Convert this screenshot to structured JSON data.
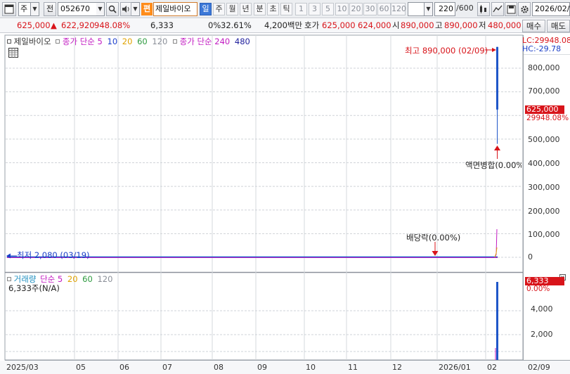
{
  "toolbar": {
    "market": "주",
    "prev_label": "전",
    "code": "052670",
    "stock_name": "제일바이오",
    "badge": "편",
    "periods": [
      "일",
      "주",
      "월",
      "년",
      "분",
      "초",
      "틱"
    ],
    "numbers": [
      "1",
      "3",
      "5",
      "10",
      "20",
      "30",
      "60",
      "120"
    ],
    "count_value": "220",
    "count_total": "/600",
    "date": "2026/02/"
  },
  "quote": {
    "price": "625,000",
    "change_arrow": "▲",
    "change": "622,920",
    "change_pct": "948.08%",
    "volume": "6,333",
    "zero_pct": "0%",
    "turnover_pct": "32.61%",
    "amount": "4,200백만",
    "bid_label": "호가",
    "ask": "625,000",
    "bid": "624,000",
    "open_label": "시",
    "open": "890,000",
    "high_label": "고",
    "high": "890,000",
    "low_label": "저",
    "low": "480,000",
    "buy_label": "매수",
    "sell_label": "매도"
  },
  "price_panel": {
    "legend_name": "제일바이오",
    "ma_label": "종가 단순",
    "ma_periods": [
      "5",
      "10",
      "20",
      "60",
      "120"
    ],
    "ma_colors": [
      "#c21bc2",
      "#1e3fcc",
      "#e0a200",
      "#2e9b40",
      "#8a8f98"
    ],
    "ma2_label": "종가 단순",
    "ma2_periods": [
      "240",
      "480"
    ],
    "ma2_colors": [
      "#c21bc2",
      "#1e1e9c"
    ],
    "high_annotation": "최고 890,000 (02/09)",
    "low_annotation": "최저 2,080 (03/19)",
    "split_annotation": "액면병합(0.00%",
    "dividend_annotation": "배당락(0.00%)",
    "lc_label": "LC:29948.08",
    "hc_label": "HC:-29.78",
    "axis_ticks": [
      "800,000",
      "700,000",
      "600,000",
      "500,000",
      "400,000",
      "300,000",
      "200,000",
      "100,000",
      "0"
    ],
    "current_price_tag": "625,000",
    "current_sub_tag": "29948.08%"
  },
  "volume_panel": {
    "legend_name": "거래량",
    "ma_label": "단순",
    "ma_periods": [
      "5",
      "20",
      "60",
      "120"
    ],
    "ma_colors": [
      "#c21bc2",
      "#e0a200",
      "#2e9b40",
      "#8a8f98"
    ],
    "value_text": "6,333주(N/A)",
    "axis_ticks": [
      "4,000",
      "2,000"
    ],
    "current_tag": "6,333",
    "current_sub_tag": "0.00%"
  },
  "x_axis": {
    "labels": [
      "2025/03",
      "05",
      "06",
      "07",
      "08",
      "09",
      "10",
      "11",
      "12",
      "2026/01",
      "02",
      "02/09"
    ]
  },
  "colors": {
    "rise": "#d8141a",
    "fall": "#1a3fc7",
    "candle_blue": "#1f56c8"
  }
}
